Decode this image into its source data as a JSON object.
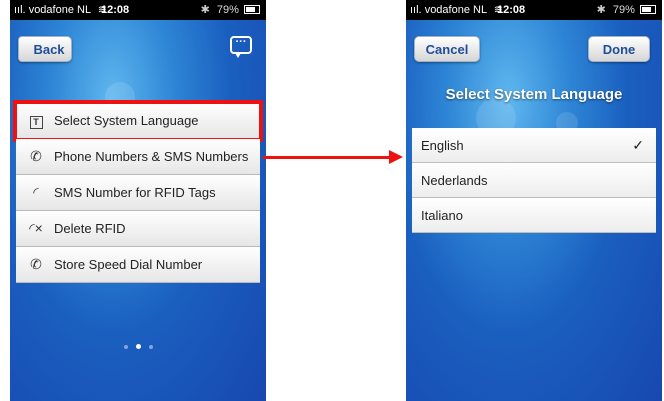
{
  "left_screen": {
    "status": {
      "carrier": "vodafone NL",
      "time": "12:08",
      "battery": "79%"
    },
    "back_label": "Back",
    "menu": [
      {
        "label": "Select System Language",
        "icon": "text-icon"
      },
      {
        "label": "Phone Numbers & SMS Numbers",
        "icon": "phone-add-icon"
      },
      {
        "label": "SMS Number for RFID Tags",
        "icon": "rfid-icon"
      },
      {
        "label": "Delete RFID",
        "icon": "rfid-delete-icon"
      },
      {
        "label": "Store Speed Dial Number",
        "icon": "phone-icon"
      }
    ],
    "page_indicator": {
      "count": 3,
      "active": 2
    }
  },
  "right_screen": {
    "status": {
      "carrier": "vodafone NL",
      "time": "12:08",
      "battery": "79%"
    },
    "cancel_label": "Cancel",
    "done_label": "Done",
    "title": "Select System Language",
    "languages": [
      {
        "label": "English",
        "selected": true,
        "check": "✓"
      },
      {
        "label": "Nederlands",
        "selected": false
      },
      {
        "label": "Italiano",
        "selected": false
      }
    ]
  },
  "colors": {
    "highlight": "#ee1111",
    "nav_text": "#1f4e99"
  }
}
